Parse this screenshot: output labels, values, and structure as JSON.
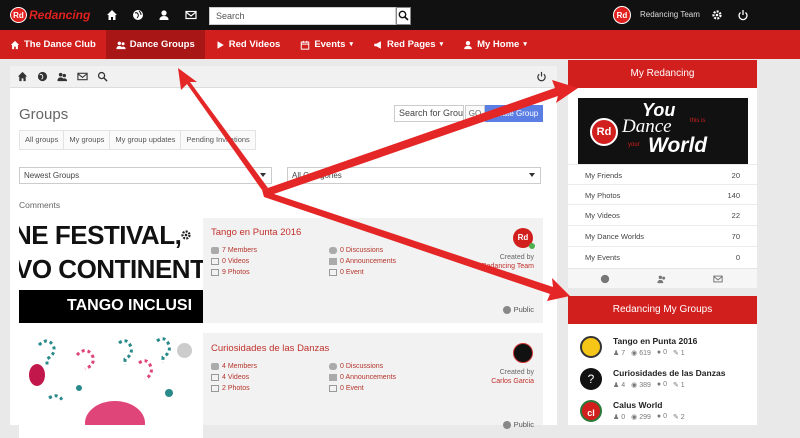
{
  "topbar": {
    "logo_badge": "Rd",
    "logo_text": "Redancing",
    "search_placeholder": "Search",
    "user_avatar": "Rd",
    "user_name": "Redancing Team"
  },
  "nav": [
    {
      "label": "The Dance Club",
      "icon": "home-icon",
      "caret": false,
      "active": false
    },
    {
      "label": "Dance Groups",
      "icon": "users-icon",
      "caret": false,
      "active": true
    },
    {
      "label": "Red Videos",
      "icon": "play-icon",
      "caret": false,
      "active": false
    },
    {
      "label": "Events",
      "icon": "calendar-icon",
      "caret": true,
      "active": false
    },
    {
      "label": "Red Pages",
      "icon": "megaphone-icon",
      "caret": true,
      "active": false
    },
    {
      "label": "My Home",
      "icon": "user-icon",
      "caret": true,
      "active": false
    }
  ],
  "main": {
    "title": "Groups",
    "search_value": "Search for Groups",
    "go_label": "GO",
    "create_label": "Create Group",
    "subtabs": [
      "All groups",
      "My groups",
      "My group updates",
      "Pending Invitations"
    ],
    "sort_select": "Newest Groups",
    "category_select": "All Categories",
    "comments_label": "Comments",
    "created_by_label": "Created by",
    "public_label": "Public"
  },
  "groups": [
    {
      "title": "Tango en Punta 2016",
      "members": "7 Members",
      "videos": "0 Videos",
      "photos": "9 Photos",
      "discussions": "0 Discussions",
      "announcements": "0 Announcements",
      "events": "0 Event",
      "creator": "Redancing Team",
      "creator_avatar": "Rd",
      "banner_lines": [
        "NE FESTIVAL,",
        "VO CONTINENT",
        "TANGO INCLUSI"
      ]
    },
    {
      "title": "Curiosidades de las Danzas",
      "members": "4 Members",
      "videos": "4 Videos",
      "photos": "2 Photos",
      "discussions": "0 Discussions",
      "announcements": "0 Announcements",
      "events": "0 Event",
      "creator": "Carlos Garcia"
    }
  ],
  "sidebar": {
    "my_redancing_title": "My Redancing",
    "banner": {
      "badge": "Rd",
      "word1": "You",
      "word2": "Dance",
      "word3": "World",
      "small1": "this is",
      "small2": "your"
    },
    "rows": [
      {
        "label": "My Friends",
        "value": "20"
      },
      {
        "label": "My Photos",
        "value": "140"
      },
      {
        "label": "My Videos",
        "value": "22"
      },
      {
        "label": "My Dance Worlds",
        "value": "70"
      },
      {
        "label": "My Events",
        "value": "0"
      }
    ],
    "groups_title": "Redancing My Groups",
    "my_groups": [
      {
        "name": "Tango en Punta 2016",
        "members": "7",
        "views": "619",
        "comments": "0",
        "likes": "1"
      },
      {
        "name": "Curiosidades de las Danzas",
        "members": "4",
        "views": "389",
        "comments": "0",
        "likes": "1"
      },
      {
        "name": "Calus World",
        "members": "0",
        "views": "299",
        "comments": "0",
        "likes": "2"
      }
    ]
  },
  "colors": {
    "brand_red": "#d11f1e",
    "dark": "#111111",
    "link_red": "#c0302b",
    "create_blue": "#5b7ee5"
  }
}
